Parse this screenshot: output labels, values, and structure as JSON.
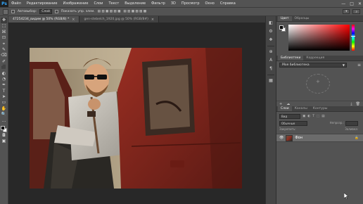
{
  "app": {
    "logo": "Ps"
  },
  "menu": [
    "Файл",
    "Редактирование",
    "Изображение",
    "Слои",
    "Текст",
    "Выделение",
    "Фильтр",
    "3D",
    "Просмотр",
    "Окно",
    "Справка"
  ],
  "window_controls": {
    "minimize": "—",
    "maximize": "□",
    "close": "✕"
  },
  "options_bar": {
    "auto_select_label": "Автовыбор:",
    "auto_select_target": "Слой",
    "show_transform_label": "Показать упр. элем."
  },
  "documents": {
    "tabs": [
      {
        "label": "47254234_видим @ 50% (RGB/8) *",
        "close": "×"
      },
      {
        "label": "gen-stebelch_1920.jpg @ 50% (RGB/8#)",
        "close": "×"
      }
    ]
  },
  "panels": {
    "color": {
      "tabs": [
        "Цвет",
        "Образцы"
      ],
      "hue_position": 0.43
    },
    "libraries": {
      "tabs": [
        "Библиотеки",
        "Коррекция"
      ],
      "selected": "Моя библиотека",
      "menu_icon": "≡",
      "footer_left": [
        "+",
        "☁"
      ],
      "footer_right": [
        "⤓",
        "🗑"
      ]
    },
    "layers": {
      "tabs": [
        "Слои",
        "Каналы",
        "Контуры"
      ],
      "filter_kind": "Вид",
      "filter_icons": [
        "▣",
        "◐",
        "T",
        "⬚",
        "▤"
      ],
      "blend_mode": "Обычные",
      "opacity_label": "Непрозр.:",
      "opacity_value": "",
      "lock_label": "Закрепить:",
      "fill_label": "Заливка:",
      "layer": {
        "name": "Фон",
        "lock": "🔒",
        "visible": true
      },
      "footer_icons": [
        "⛓",
        "fx",
        "◑",
        "◒",
        "▭",
        "⊞",
        "🗑"
      ]
    }
  },
  "tools": [
    "✥",
    "⬚",
    "⌘",
    "⊡",
    "⌖",
    "✎",
    "⌫",
    "✐",
    "⬛",
    "◐",
    "◔",
    "✒",
    "T",
    "➤",
    "▭",
    "✋",
    "🔍",
    "…"
  ],
  "dock_icons": [
    "◧",
    "⚙",
    "❖",
    "⊕",
    "A",
    "¶",
    "▦"
  ],
  "colors": {
    "accent": "#31a8ff",
    "panel_bg": "#535353",
    "canvas_bg": "#282828",
    "selected_layer": "#6b6b6b"
  }
}
